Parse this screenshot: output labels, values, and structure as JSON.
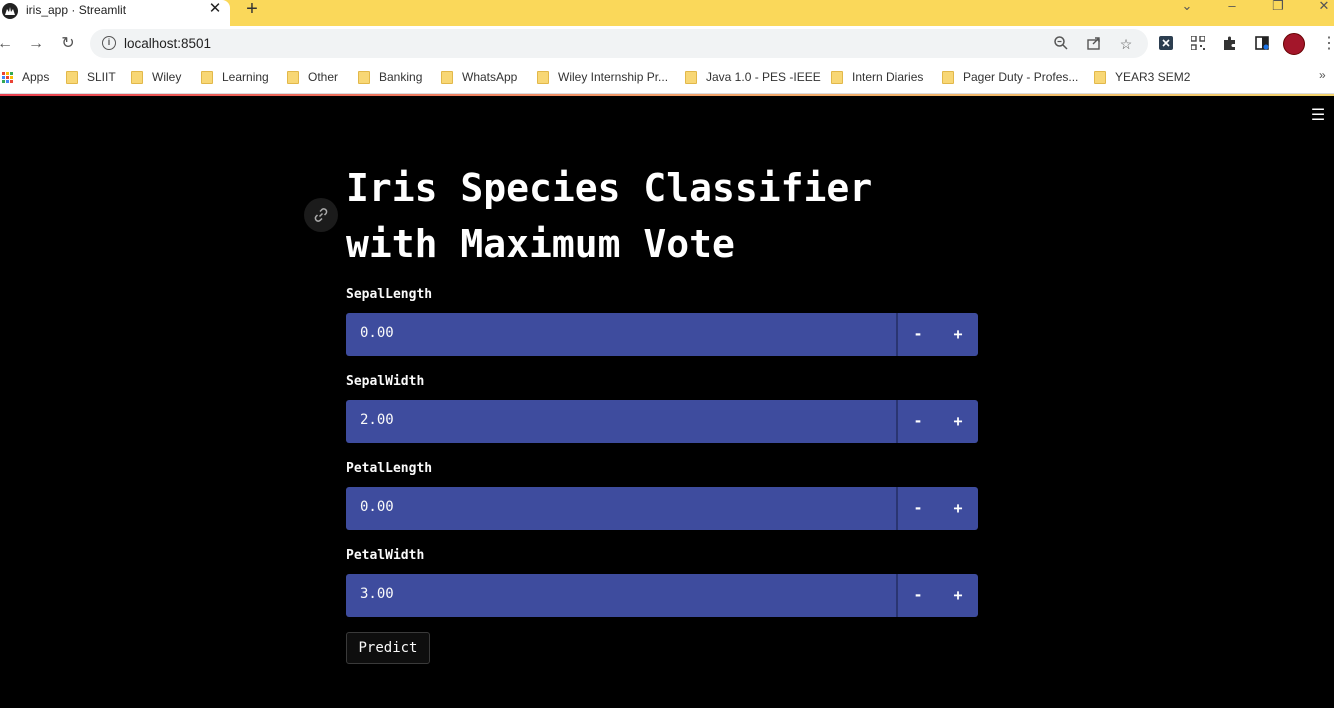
{
  "browser": {
    "tab_title": "iris_app · Streamlit",
    "url": "localhost:8501",
    "bookmarks": [
      {
        "label": "Apps",
        "icon": "apps-grid-icon"
      },
      {
        "label": "SLIIT",
        "icon": "folder-icon"
      },
      {
        "label": "Wiley",
        "icon": "folder-icon"
      },
      {
        "label": "Learning",
        "icon": "folder-icon"
      },
      {
        "label": "Other",
        "icon": "folder-icon"
      },
      {
        "label": "Banking",
        "icon": "folder-icon"
      },
      {
        "label": "WhatsApp",
        "icon": "folder-icon"
      },
      {
        "label": "Wiley Internship Pr...",
        "icon": "folder-icon"
      },
      {
        "label": "Java 1.0  - PES -IEEE",
        "icon": "folder-icon"
      },
      {
        "label": "Intern Diaries",
        "icon": "folder-icon"
      },
      {
        "label": "Pager Duty - Profes...",
        "icon": "folder-icon"
      },
      {
        "label": "YEAR3 SEM2",
        "icon": "folder-icon"
      }
    ],
    "bookmarks_overflow": "»"
  },
  "app": {
    "title": "Iris Species Classifier with Maximum Vote",
    "inputs": [
      {
        "label": "SepalLength",
        "value": "0.00"
      },
      {
        "label": "SepalWidth",
        "value": "2.00"
      },
      {
        "label": "PetalLength",
        "value": "0.00"
      },
      {
        "label": "PetalWidth",
        "value": "3.00"
      }
    ],
    "decrement_label": "-",
    "increment_label": "+",
    "predict_label": "Predict"
  },
  "colors": {
    "tabstrip": "#fad85a",
    "input_bg": "#3e4c9e",
    "page_bg": "#000000"
  }
}
